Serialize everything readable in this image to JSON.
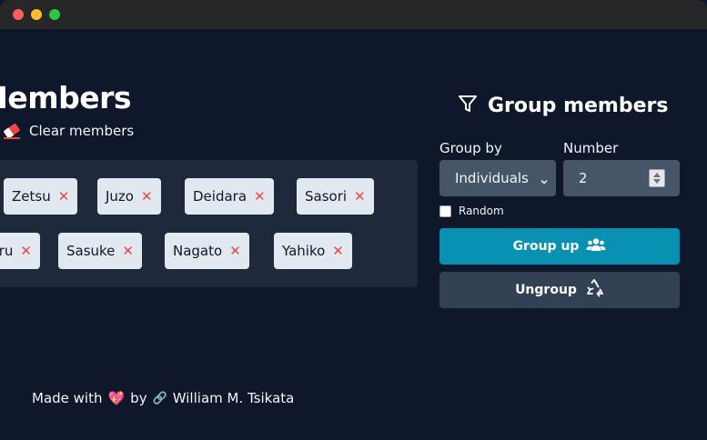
{
  "members_panel": {
    "title": "Members",
    "clear_label": "Clear members",
    "members": [
      "Zetsu",
      "Juzo",
      "Deidara",
      "Sasori",
      "ru",
      "Sasuke",
      "Nagato",
      "Yahiko"
    ],
    "remove_glyph": "✕"
  },
  "group_panel": {
    "title": "Group members",
    "group_by_label": "Group by",
    "group_by_value": "Individuals",
    "number_label": "Number",
    "number_value": "2",
    "random_label": "Random",
    "group_up_label": "Group up",
    "ungroup_label": "Ungroup"
  },
  "footer": {
    "made_with": "Made with",
    "heart": "💖",
    "by": "by",
    "link_glyph": "🔗",
    "author": "William M. Tsikata"
  },
  "colors": {
    "background": "#0f172a",
    "panel": "#1e293b",
    "chip": "#e2e8f0",
    "remove": "#ef4444",
    "primary_button": "#0891b2",
    "secondary_button": "#334155",
    "input": "#475569"
  },
  "icons": [
    "eraser-icon",
    "filter-icon",
    "chevron-down-icon",
    "users-icon",
    "recycle-icon",
    "link-icon"
  ]
}
